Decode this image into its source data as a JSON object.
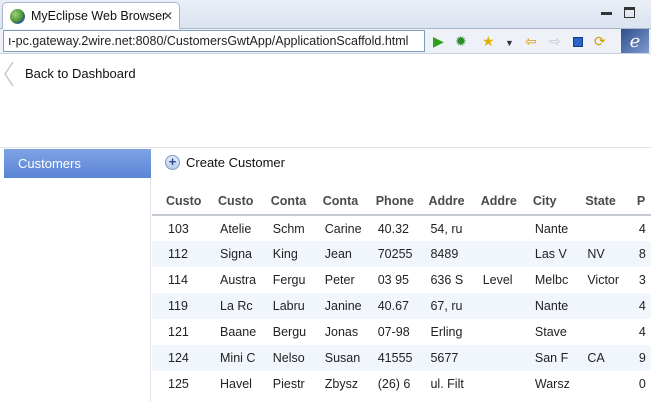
{
  "window": {
    "tab_title": "MyEclipse Web Browser",
    "url": "ı-pc.gateway.2wire.net:8080/CustomersGwtApp/ApplicationScaffold.html"
  },
  "icons": {
    "tab": "globe-icon",
    "toolbar": [
      "run-icon",
      "debug-icon",
      "favorite-star-icon",
      "dropdown-arrow-icon",
      "back-arrow-icon",
      "forward-arrow-icon",
      "stop-icon",
      "refresh-icon",
      "myeclipse-logo-icon"
    ]
  },
  "page": {
    "back_link": "Back to Dashboard",
    "sidebar_items": [
      "Customers"
    ],
    "create_label": "Create Customer"
  },
  "table": {
    "columns": [
      "Custo",
      "Custo",
      "Conta",
      "Conta",
      "Phone",
      "Addre",
      "Addre",
      "City",
      "State",
      "P"
    ],
    "rows": [
      [
        "103",
        "Atelie",
        "Schm",
        "Carine",
        "40.32",
        "54, ru",
        "",
        "Nante",
        "",
        "4"
      ],
      [
        "112",
        "Signa",
        "King",
        "Jean",
        "70255",
        "8489",
        "",
        "Las V",
        "NV",
        "8"
      ],
      [
        "114",
        "Austra",
        "Fergu",
        "Peter",
        "03 95",
        "636 S",
        "Level",
        "Melbc",
        "Victor",
        "3"
      ],
      [
        "119",
        "La Rc",
        "Labru",
        "Janine",
        "40.67",
        "67, ru",
        "",
        "Nante",
        "",
        "4"
      ],
      [
        "121",
        "Baane",
        "Bergu",
        "Jonas",
        "07-98",
        "Erling",
        "",
        "Stave",
        "",
        "4"
      ],
      [
        "124",
        "Mini C",
        "Nelso",
        "Susan",
        "41555",
        "5677",
        "",
        "San F",
        "CA",
        "9"
      ],
      [
        "125",
        "Havel",
        "Piestr",
        "Zbysz",
        "(26) 6",
        "ul. Filt",
        "",
        "Warsz",
        "",
        "0"
      ]
    ]
  },
  "colors": {
    "selected_sidebar": "#5a84d6",
    "alt_row": "#f1f5fc"
  }
}
